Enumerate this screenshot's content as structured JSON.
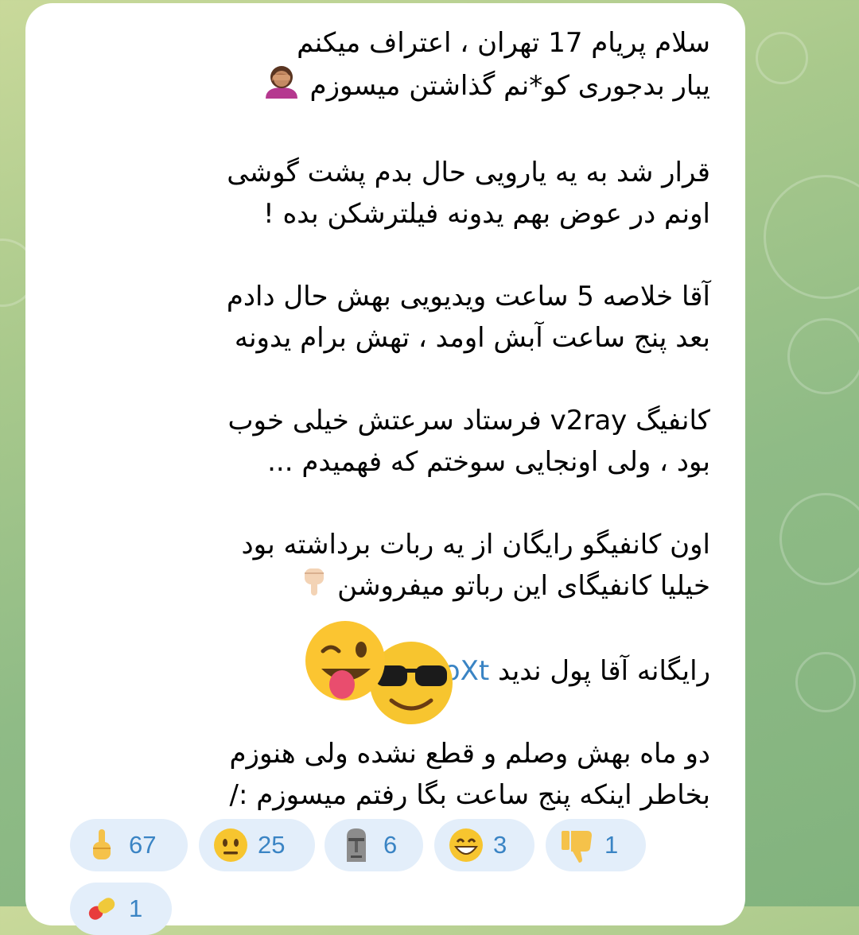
{
  "message": {
    "paragraphs": [
      {
        "lines": [
          "سلام پریام 17 تهران ، اعتراف میکنم",
          "یبار بدجوری کو*نم گذاشتن میسوزم"
        ]
      },
      {
        "lines": [
          "قرار شد به یه یارویی حال بدم پشت گوشی",
          "اونم در عوض بهم یدونه فیلترشکن بده !"
        ]
      },
      {
        "lines": [
          "آقا خلاصه 5 ساعت ویدیویی بهش حال دادم",
          "بعد پنج ساعت آبش اومد ، تهش برام یدونه"
        ]
      },
      {
        "lines": [
          "کانفیگ v2ray فرستاد سرعتش خیلی خوب",
          "بود ، ولی اونجایی سوختم که فهمیدم ..."
        ]
      },
      {
        "lines": [
          "اون کانفیگو رایگان از یه ربات برداشته بود",
          "خیلیا کانفیگای این رباتو میفروشن"
        ]
      }
    ],
    "link_prefix": "رایگانه آقا پول ندید",
    "link_text": "@ProXt",
    "final_lines": [
      "دو ماه بهش وصلم و قطع نشده ولی هنوزم",
      "بخاطر اینکه پنج ساعت بگا رفتم میسوزم :/"
    ]
  },
  "icons": {
    "facepalm": "woman-facepalming-icon",
    "pointing": "backhand-index-pointing-down-icon",
    "sticker1": "winking-face-with-tongue-icon",
    "sticker2": "smiling-face-with-sunglasses-icon"
  },
  "reactions": [
    {
      "icon": "middle-finger-icon",
      "count": "67"
    },
    {
      "icon": "neutral-face-icon",
      "count": "25"
    },
    {
      "icon": "moai-icon",
      "count": "6"
    },
    {
      "icon": "grinning-face-icon",
      "count": "3"
    },
    {
      "icon": "thumbs-down-icon",
      "count": "1"
    },
    {
      "icon": "pill-icon",
      "count": "1"
    }
  ],
  "colors": {
    "link": "#3a84c4",
    "reaction_bg": "#e3eefa",
    "bubble": "#ffffff"
  }
}
